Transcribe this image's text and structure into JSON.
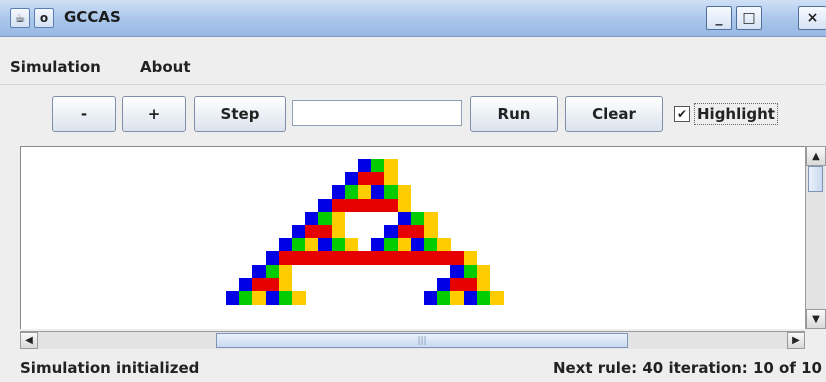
{
  "window": {
    "title": "GCCAS",
    "icons": [
      "java-icon",
      "circle-icon"
    ],
    "controls": {
      "minimize": "_",
      "maximize": "□",
      "close": "×"
    }
  },
  "menu": [
    "Simulation",
    "About"
  ],
  "toolbar": {
    "minus_label": "-",
    "plus_label": "+",
    "step_label": "Step",
    "input_value": "",
    "run_label": "Run",
    "clear_label": "Clear",
    "highlight_label": "Highlight",
    "highlight_checked": true
  },
  "status": {
    "left": "Simulation initialized",
    "right": "Next rule: 40 iteration: 10 of 10"
  },
  "automaton": {
    "colors": {
      "b": "#0000e6",
      "g": "#00cc00",
      "r": "#e60000",
      "y": "#ffcc00"
    },
    "rows": [
      [
        {
          "c": 10,
          "s": "bgy"
        }
      ],
      [
        {
          "c": 9,
          "s": "brry"
        }
      ],
      [
        {
          "c": 8,
          "s": "bgybgy"
        }
      ],
      [
        {
          "c": 7,
          "s": "brrrrry"
        }
      ],
      [
        {
          "c": 6,
          "s": "bgy",
          "k": 2
        },
        {
          "c": 13,
          "s": "bgy"
        }
      ],
      [
        {
          "c": 5,
          "s": "brry",
          "k": 2
        },
        {
          "c": 12,
          "s": "brry"
        }
      ],
      [
        {
          "c": 4,
          "s": "bgybgy"
        },
        {
          "c": 11,
          "s": "bgybgy"
        }
      ],
      [
        {
          "c": 3,
          "s": "brrrrrrrrrrrrrry"
        }
      ],
      [
        {
          "c": 2,
          "s": "bgy"
        },
        {
          "c": 17,
          "s": "bgy"
        }
      ],
      [
        {
          "c": 1,
          "s": "brry"
        },
        {
          "c": 16,
          "s": "brry"
        }
      ],
      [
        {
          "c": 0,
          "s": "bgybgy"
        },
        {
          "c": 15,
          "s": "bgybgy"
        }
      ]
    ]
  }
}
